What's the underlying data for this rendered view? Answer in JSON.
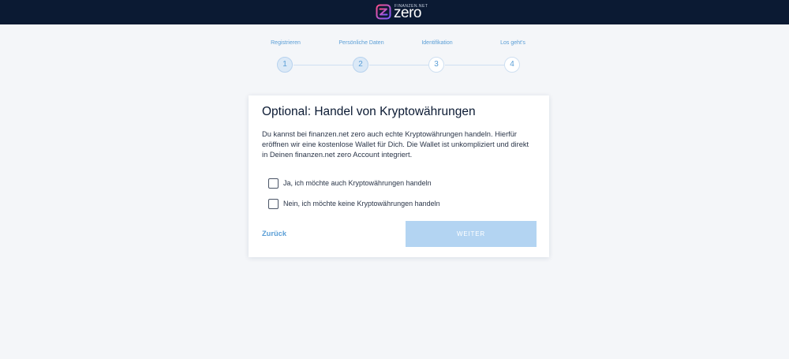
{
  "header": {
    "brand_small": "FINANZEN.NET",
    "brand_word": "zero",
    "logo_icon": "z-logo-icon",
    "colors": {
      "background": "#0b1a33",
      "logo_gradient": [
        "#7b5cff",
        "#ff4f8b"
      ]
    }
  },
  "stepper": {
    "steps": [
      {
        "label": "Registrieren",
        "number": "1",
        "state": "done"
      },
      {
        "label": "Persönliche Daten",
        "number": "2",
        "state": "done"
      },
      {
        "label": "Identifikation",
        "number": "3",
        "state": "todo"
      },
      {
        "label": "Los geht's",
        "number": "4",
        "state": "todo"
      }
    ],
    "accent": "#5a9ed6"
  },
  "card": {
    "title": "Optional: Handel von Kryptowährungen",
    "description": "Du kannst bei finanzen.net zero auch echte Kryptowährungen handeln. Hierfür eröffnen wir eine kostenlose Wallet für Dich. Die Wallet ist unkompliziert und direkt in Deinen finanzen.net zero Account integriert.",
    "options": [
      {
        "label": "Ja, ich möchte auch Kryptowährungen handeln",
        "checked": false
      },
      {
        "label": "Nein, ich möchte keine Kryptowährungen handeln",
        "checked": false
      }
    ],
    "back_label": "Zurück",
    "next_label": "WEITER",
    "next_disabled": true
  }
}
